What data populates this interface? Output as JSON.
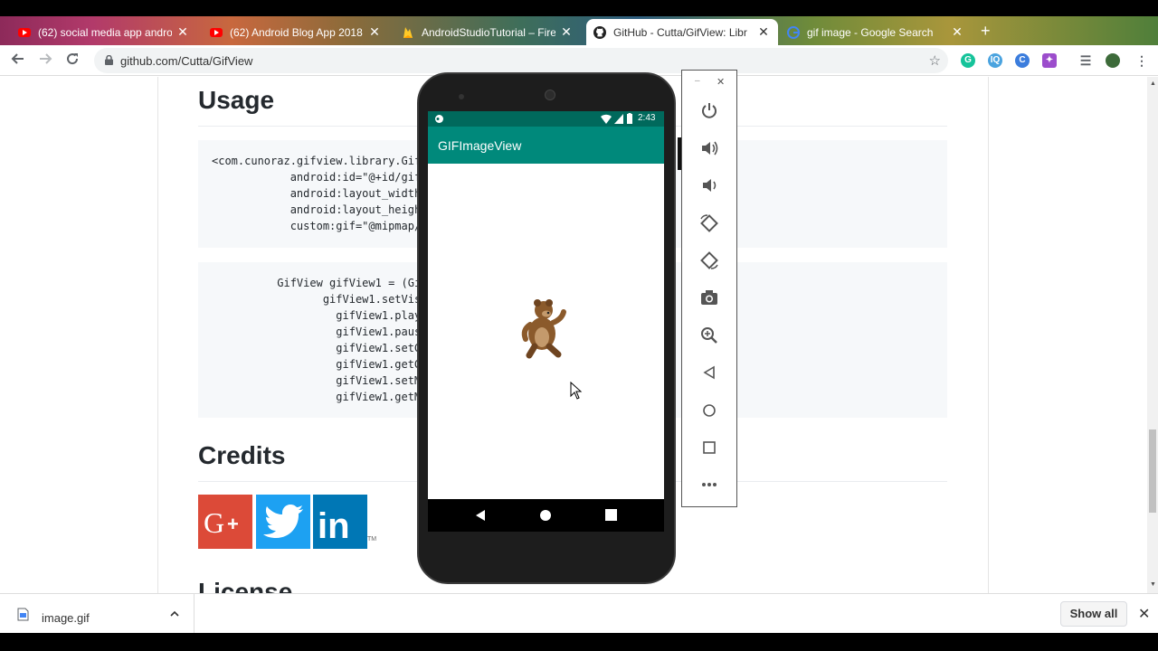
{
  "browser": {
    "tabs": [
      {
        "title": "(62) social media app androi",
        "favicon": "youtube-icon"
      },
      {
        "title": "(62) Android Blog App 2018",
        "favicon": "youtube-icon"
      },
      {
        "title": "AndroidStudioTutorial – Fire",
        "favicon": "firebase-icon"
      },
      {
        "title": "GitHub - Cutta/GifView: Libr",
        "favicon": "github-icon"
      },
      {
        "title": "gif image - Google Search",
        "favicon": "google-icon"
      }
    ],
    "active_tab": 3,
    "url": "github.com/Cutta/GifView",
    "new_tab": "+",
    "close_glyph": "✕"
  },
  "page": {
    "usage_heading": "Usage",
    "xml_code": [
      "<com.cunoraz.gifview.library.GifV",
      "            android:id=\"@+id/gif",
      "            android:layout_width",
      "            android:layout_heigh",
      "            custom:gif=\"@mipmap/"
    ],
    "java_code": [
      "          GifView gifView1 = (Gi",
      "                 gifView1.setVis",
      "                   gifView1.play",
      "                   gifView1.paus",
      "                   gifView1.setG",
      "                   gifView1.getG",
      "                   gifView1.setM",
      "                   gifView1.getM"
    ],
    "credits_heading": "Credits",
    "license_heading": "License",
    "social": [
      "Google+",
      "Twitter",
      "LinkedIn"
    ],
    "trademark": "TM",
    "colors": {
      "googleplus": "#dc4a38",
      "twitter": "#1da1f2",
      "linkedin": "#0077b5"
    }
  },
  "emulator": {
    "status_time": "2:43",
    "app_title": "GIFImageView",
    "colors": {
      "statusbar": "#00695c",
      "appbar": "#00897b"
    },
    "nav_buttons": [
      "back-icon",
      "home-icon",
      "recents-icon"
    ],
    "panel": {
      "window_controls": [
        "minimize-icon",
        "close-icon"
      ],
      "buttons": [
        "power-icon",
        "volume-up-icon",
        "volume-down-icon",
        "rotate-left-icon",
        "rotate-right-icon",
        "camera-icon",
        "zoom-icon",
        "back-icon",
        "home-icon",
        "overview-icon",
        "more-icon"
      ]
    }
  },
  "downloads": {
    "file_name": "image.gif",
    "show_all": "Show all"
  }
}
